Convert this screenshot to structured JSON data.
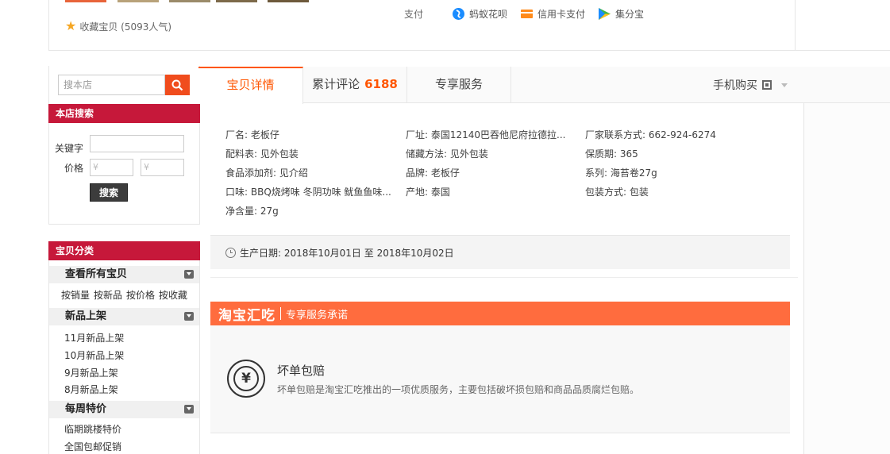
{
  "top": {
    "favorite_label": "收藏宝贝 (5093人气)",
    "pay_label": "支付",
    "pay_methods": [
      {
        "label": "蚂蚁花呗",
        "icon": "huabei-icon",
        "color": "#1a8cff"
      },
      {
        "label": "信用卡支付",
        "icon": "credit-card-icon",
        "color": "#ff8a1a"
      },
      {
        "label": "集分宝",
        "icon": "jifenbao-icon",
        "color": "#3cb44b"
      }
    ]
  },
  "sidebar": {
    "search_placeholder": "搜本店",
    "store_search_title": "本店搜索",
    "keyword_label": "关键字",
    "price_label": "价格",
    "price_min_placeholder": "¥",
    "price_max_placeholder": "¥",
    "submit_label": "搜索",
    "category_title": "宝贝分类",
    "groups": [
      {
        "title": "查看所有宝贝"
      },
      {
        "title": "新品上架"
      },
      {
        "title": "每周特价"
      }
    ],
    "sort_links": [
      "按销量",
      "按新品",
      "按价格",
      "按收藏"
    ],
    "new_links": [
      "11月新品上架",
      "10月新品上架",
      "9月新品上架",
      "8月新品上架"
    ],
    "special_links": [
      "临期跳楼特价",
      "全国包邮促销"
    ]
  },
  "tabs": {
    "detail": "宝贝详情",
    "reviews": "累计评论",
    "review_count": "6188",
    "service": "专享服务",
    "mobile_buy": "手机购买"
  },
  "attributes": [
    "厂名: 老板仔",
    "厂址: 泰国12140巴吞他尼府拉德拉...",
    "厂家联系方式: 662-924-6274",
    "配料表: 见外包装",
    "储藏方法: 见外包装",
    "保质期: 365",
    "食品添加剂: 见介绍",
    "品牌: 老板仔",
    "系列: 海苔卷27g",
    "口味: BBQ烧烤味 冬阴功味 鱿鱼鱼味...",
    "产地: 泰国",
    "包装方式: 包装",
    "净含量: 27g"
  ],
  "production_date": "生产日期: 2018年10月01日 至 2018年10月02日",
  "service": {
    "brand": "淘宝汇吃",
    "subtitle": "专享服务承诺",
    "item_title": "坏单包赔",
    "item_desc": "坏单包赔是淘宝汇吃推出的一项优质服务，主要包括破坏损包赔和商品品质腐烂包赔。",
    "accent": "#ff6c3e"
  }
}
